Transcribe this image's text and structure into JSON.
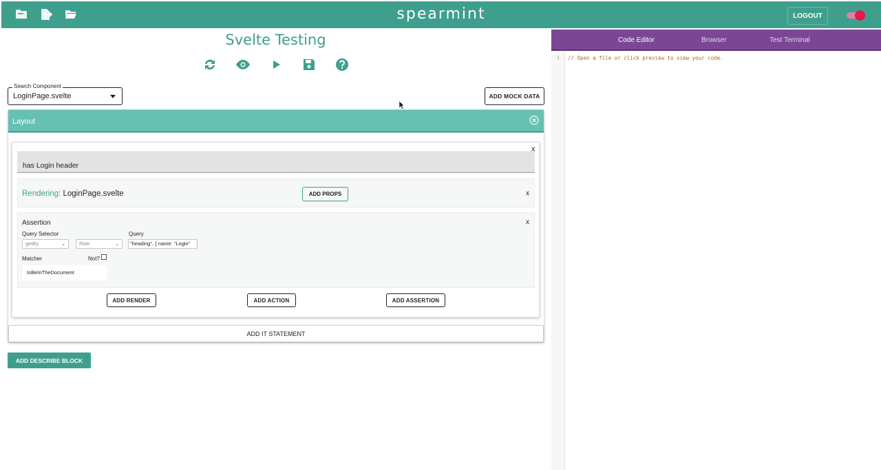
{
  "header": {
    "brand": "spearmint",
    "logout_label": "LOGOUT",
    "icons": [
      "new-file-icon",
      "export-file-icon",
      "open-folder-icon"
    ],
    "theme_toggle_on": true,
    "colors": {
      "bar": "#3f9f8d",
      "toggle": "#e8174f"
    }
  },
  "left": {
    "page_title": "Svelte Testing",
    "action_icons": [
      "refresh-icon",
      "preview-eye-icon",
      "run-play-icon",
      "save-icon",
      "help-icon"
    ],
    "search": {
      "label": "Search Component",
      "value": "LoginPage.svelte"
    },
    "mock_data_label": "ADD MOCK DATA",
    "layout": {
      "title": "Layout",
      "it_block": {
        "title": "has Login header",
        "close": "x",
        "render": {
          "prefix": "Rendering:",
          "component": "LoginPage.svelte",
          "add_props_label": "ADD PROPS",
          "close": "x"
        },
        "assertion": {
          "heading": "Assertion",
          "close": "x",
          "query_selector_label": "Query Selector",
          "query_label": "Query",
          "selector_value": "getBy",
          "role_value": "Role",
          "query_value": "\"heading\", { name: \"Login\"",
          "matcher_label": "Matcher",
          "not_label": "Not?",
          "matcher_value": "toBeInTheDocument"
        },
        "buttons": {
          "add_render": "ADD RENDER",
          "add_action": "ADD ACTION",
          "add_assertion": "ADD ASSERTION"
        }
      }
    },
    "add_it_label": "ADD IT STATEMENT",
    "add_describe_label": "ADD DESCRIBE BLOCK"
  },
  "right": {
    "tabs": [
      {
        "label": "Code Editor",
        "active": true
      },
      {
        "label": "Browser",
        "active": false
      },
      {
        "label": "Test Terminal",
        "active": false
      }
    ],
    "line_number": "1",
    "code_text": "// Open a file or click preview to view your code.",
    "colors": {
      "tab_bar": "#7b4795"
    }
  }
}
